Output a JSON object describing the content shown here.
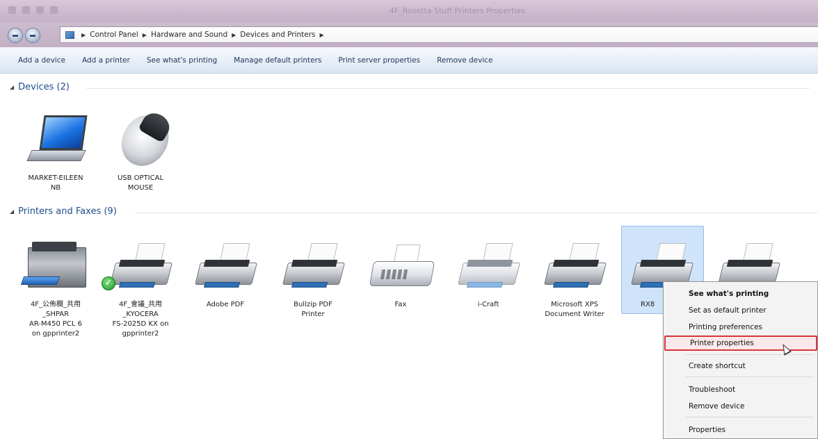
{
  "window": {
    "title": "4F_Rosetta Stuff Printers Properties"
  },
  "address_bar": {
    "crumbs": [
      "Control Panel",
      "Hardware and Sound",
      "Devices and Printers"
    ]
  },
  "toolbar": {
    "add_device": "Add a device",
    "add_printer": "Add a printer",
    "see_printing": "See what's printing",
    "manage_default": "Manage default printers",
    "print_server": "Print server properties",
    "remove_device": "Remove device"
  },
  "devices": {
    "header": "Devices (2)",
    "items": [
      {
        "label": "MARKET-EILEEN\nNB",
        "icon": "laptop-icon"
      },
      {
        "label": "USB OPTICAL\nMOUSE",
        "icon": "mouse-icon"
      }
    ]
  },
  "printers": {
    "header": "Printers and Faxes (9)",
    "items": [
      {
        "label": "4F_公佈欄_共用\n_SHPAR\nAR-M450 PCL 6\non gpprinter2",
        "icon": "multifunction-printer-icon"
      },
      {
        "label": "4F_會議_共用\n_KYOCERA\nFS-2025D KX on\ngpprinter2",
        "icon": "printer-icon",
        "default": true
      },
      {
        "label": "Adobe PDF",
        "icon": "printer-icon"
      },
      {
        "label": "Bullzip PDF\nPrinter",
        "icon": "printer-icon"
      },
      {
        "label": "Fax",
        "icon": "fax-icon"
      },
      {
        "label": "i-Craft",
        "icon": "printer-icon"
      },
      {
        "label": "Microsoft XPS\nDocument Writer",
        "icon": "printer-icon"
      },
      {
        "label": "RX8",
        "icon": "printer-icon",
        "selected": true
      },
      {
        "label": "",
        "icon": "printer-icon"
      }
    ]
  },
  "context_menu": {
    "see_printing": "See what's printing",
    "set_default": "Set as default printer",
    "preferences": "Printing preferences",
    "printer_properties": "Printer properties",
    "create_shortcut": "Create shortcut",
    "troubleshoot": "Troubleshoot",
    "remove_device": "Remove device",
    "properties": "Properties"
  },
  "colors": {
    "highlight_border": "#d9343a",
    "selection": "#cfe3fa",
    "header_text": "#1d4e8c"
  }
}
